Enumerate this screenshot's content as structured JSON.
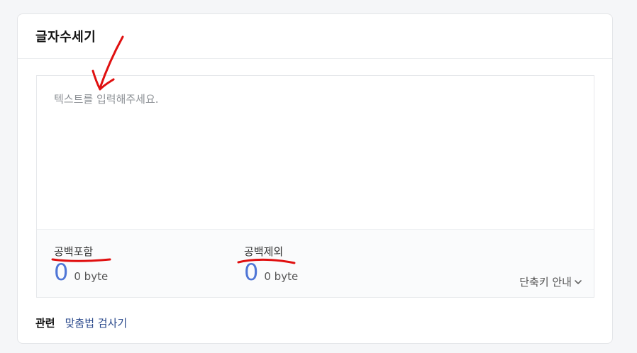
{
  "tool": {
    "title": "글자수세기",
    "input_placeholder": "텍스트를 입력해주세요."
  },
  "stats": {
    "with_spaces": {
      "label": "공백포함",
      "count": "0",
      "bytes": "0 byte"
    },
    "without_spaces": {
      "label": "공백제외",
      "count": "0",
      "bytes": "0 byte"
    }
  },
  "shortcut": {
    "label": "단축키 안내",
    "icon": "chevron-down-icon"
  },
  "related": {
    "label": "관련",
    "links": [
      "맞춤법 검사기"
    ]
  },
  "annotations": {
    "color": "#e01010"
  }
}
